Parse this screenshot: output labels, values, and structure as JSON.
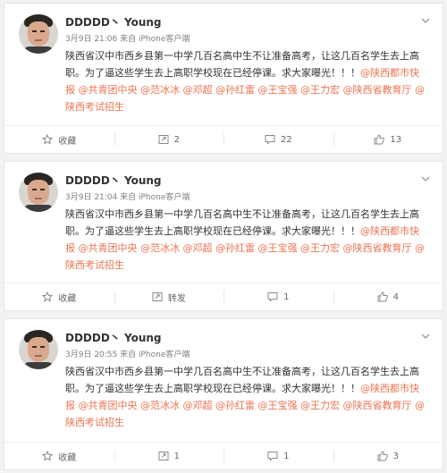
{
  "posts": [
    {
      "username": "DDDDD丶 Young",
      "date": "3月9日 21:06",
      "source": "来自 iPhone客户端",
      "body_text": "陕西省汉中市西乡县第一中学几百名高中生不让准备高考，让这几百名学生去上高职。为了逼这些学生去上高职学校现在已经停课。求大家曝光！！！",
      "mentions": [
        "@陕西都市快报",
        "@共青团中央",
        "@范冰冰",
        "@邓超",
        "@孙红雷",
        "@王宝强",
        "@王力宏",
        "@陕西省教育厅",
        "@陕西考试招生"
      ],
      "actions": {
        "favorite": "收藏",
        "repost": "2",
        "comment": "22",
        "like": "13"
      }
    },
    {
      "username": "DDDDD丶 Young",
      "date": "3月9日 21:04",
      "source": "来自 iPhone客户端",
      "body_text": "陕西省汉中市西乡县第一中学几百名高中生不让准备高考，让这几百名学生去上高职。为了逼这些学生去上高职学校现在已经停课。求大家曝光！！！",
      "mentions": [
        "@陕西都市快报",
        "@共青团中央",
        "@范冰冰",
        "@邓超",
        "@孙红雷",
        "@王宝强",
        "@王力宏",
        "@陕西省教育厅",
        "@陕西考试招生"
      ],
      "actions": {
        "favorite": "收藏",
        "repost": "转发",
        "comment": "1",
        "like": "4"
      }
    },
    {
      "username": "DDDDD丶 Young",
      "date": "3月9日 20:55",
      "source": "来自 iPhone客户端",
      "body_text": "陕西省汉中市西乡县第一中学几百名高中生不让准备高考，让这几百名学生去上高职。为了逼这些学生去上高职学校现在已经停课。求大家曝光！！！",
      "mentions": [
        "@陕西都市快报",
        "@共青团中央",
        "@范冰冰",
        "@邓超",
        "@孙红雷",
        "@王宝强",
        "@王力宏",
        "@陕西省教育厅",
        "@陕西考试招生"
      ],
      "actions": {
        "favorite": "收藏",
        "repost": "1",
        "comment": "1",
        "like": "3"
      }
    }
  ],
  "colors": {
    "mention": "#eb7350",
    "meta": "#808080",
    "text": "#333333"
  },
  "icons": {
    "menu": "chevron-down-icon",
    "favorite": "star-icon",
    "repost": "repost-icon",
    "comment": "comment-icon",
    "like": "thumbs-up-icon"
  }
}
